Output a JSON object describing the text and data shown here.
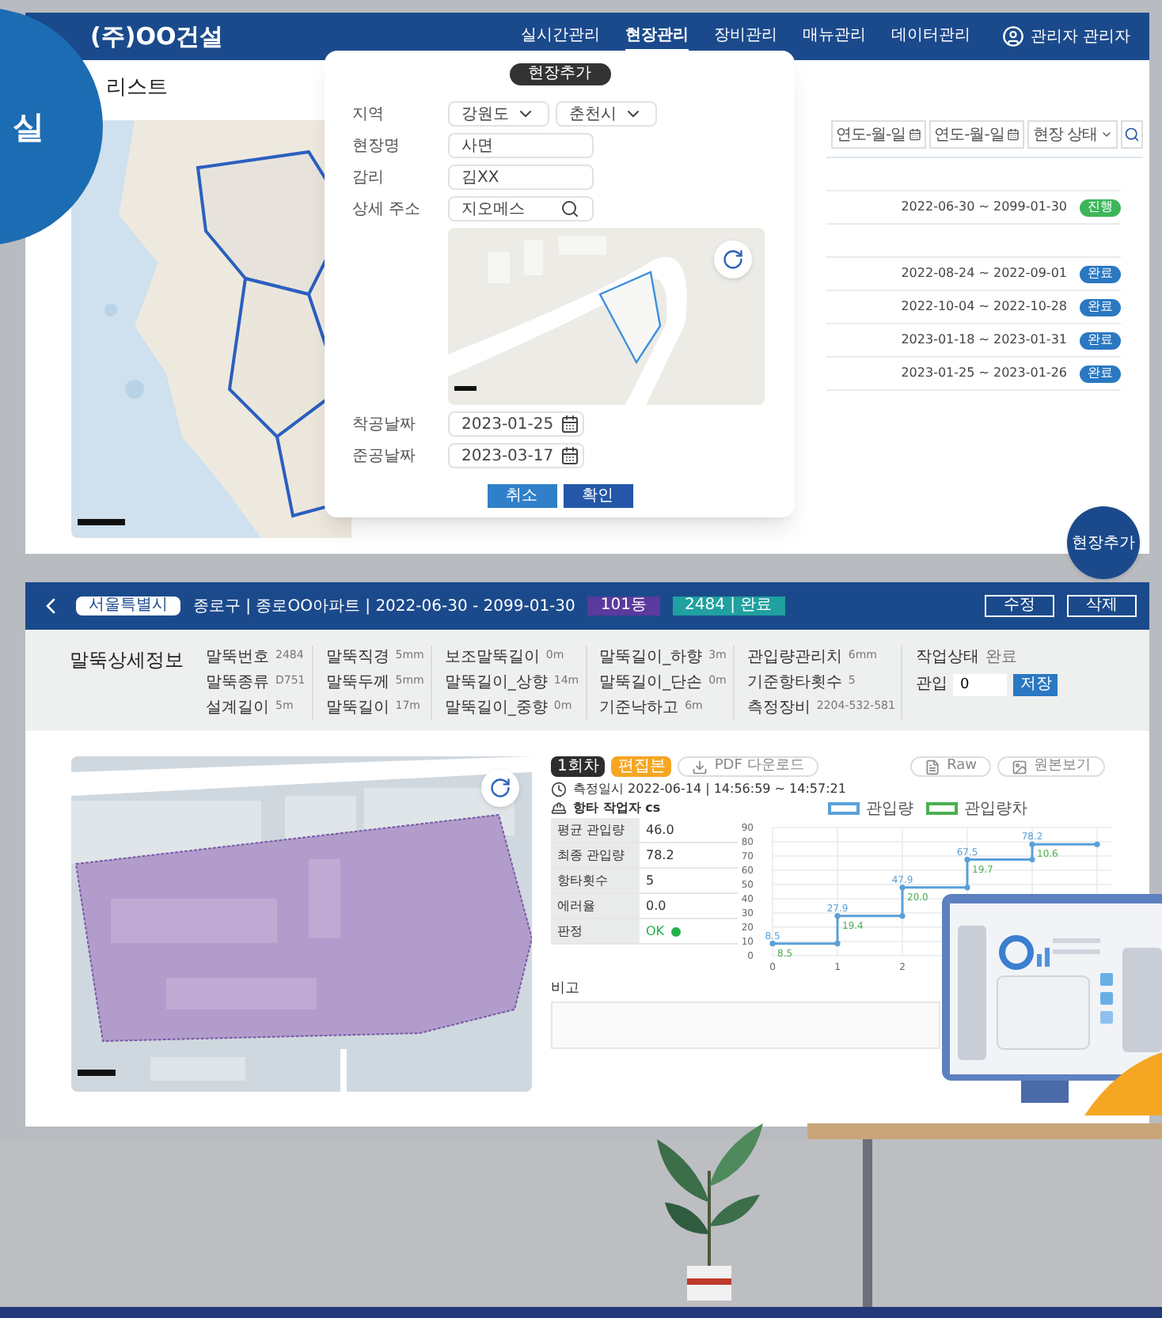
{
  "corner_badge": {
    "text": "실"
  },
  "top_window": {
    "brand": "(주)OO건설",
    "nav": [
      {
        "label": "실시간관리",
        "selected": false
      },
      {
        "label": "현장관리",
        "selected": true
      },
      {
        "label": "장비관리",
        "selected": false
      },
      {
        "label": "매뉴관리",
        "selected": false
      },
      {
        "label": "데이터관리",
        "selected": false
      }
    ],
    "user": "관리자 관리자",
    "page_title": "리스트",
    "filters": [
      {
        "kind": "date",
        "placeholder": "연도-월-일"
      },
      {
        "kind": "date",
        "placeholder": "연도-월-일"
      },
      {
        "kind": "select",
        "text": "현장 상태"
      },
      {
        "kind": "search"
      }
    ],
    "groups": [
      {
        "rows": [
          {
            "period": "2022-06-30 ~ 2099-01-30",
            "status": "진행",
            "kind": "progress"
          }
        ]
      },
      {
        "rows": [
          {
            "period": "2022-08-24 ~ 2022-09-01",
            "status": "완료",
            "kind": "done"
          },
          {
            "period": "2022-10-04 ~ 2022-10-28",
            "status": "완료",
            "kind": "done"
          },
          {
            "period": "2023-01-18 ~ 2023-01-31",
            "status": "완료",
            "kind": "done"
          },
          {
            "period": "2023-01-25 ~ 2023-01-26",
            "status": "완료",
            "kind": "done"
          }
        ]
      }
    ],
    "fab": "현장추가"
  },
  "modal": {
    "title": "현장추가",
    "fields": [
      {
        "label": "지역",
        "kind": "selects",
        "values": [
          "강원도",
          "춘천시"
        ]
      },
      {
        "label": "현장명",
        "kind": "text",
        "value": "사면"
      },
      {
        "label": "감리",
        "kind": "text",
        "value": "김XX"
      },
      {
        "label": "상세 주소",
        "kind": "search",
        "value": "지오메스"
      },
      {
        "kind": "map"
      },
      {
        "label": "착공날짜",
        "kind": "date",
        "value": "2023-01-25"
      },
      {
        "label": "준공날짜",
        "kind": "date",
        "value": "2023-03-17"
      }
    ],
    "buttons": [
      {
        "label": "취소",
        "kind": "secondary"
      },
      {
        "label": "확인",
        "kind": "primary"
      }
    ]
  },
  "bottom_window": {
    "region": "서울특별시",
    "breadcrumb": "종로구 | 종로OO아파트 | 2022-06-30 - 2099-01-30",
    "tags": [
      {
        "text": "101동",
        "color": "#5b3a9e"
      },
      {
        "text": "2484 | 완료",
        "color": "#20a0a0"
      }
    ],
    "buttons": [
      "수정",
      "삭제"
    ],
    "info_title": "말뚝상세정보",
    "info_columns": [
      [
        {
          "label": "말뚝번호",
          "value": "2484"
        },
        {
          "label": "말뚝종류",
          "value": "D751"
        },
        {
          "label": "설계길이",
          "value": "5m"
        }
      ],
      [
        {
          "label": "말뚝직경",
          "value": "5mm"
        },
        {
          "label": "말뚝두께",
          "value": "5mm"
        },
        {
          "label": "말뚝길이",
          "value": "17m"
        }
      ],
      [
        {
          "label": "보조말뚝길이",
          "value": "0m"
        },
        {
          "label": "말뚝길이_상향",
          "value": "14m"
        },
        {
          "label": "말뚝길이_중향",
          "value": "0m"
        }
      ],
      [
        {
          "label": "말뚝길이_하향",
          "value": "3m"
        },
        {
          "label": "말뚝길이_단손",
          "value": "0m"
        },
        {
          "label": "기준낙하고",
          "value": "6m"
        }
      ],
      [
        {
          "label": "관입량관리치",
          "value": "6mm"
        },
        {
          "label": "기준항타횟수",
          "value": "5"
        },
        {
          "label": "측정장비",
          "value": "2204-532-581"
        }
      ]
    ],
    "work_status": {
      "label": "작업상태",
      "value": "완료"
    },
    "penetration": {
      "label": "관입",
      "value": "0",
      "button": "저장"
    },
    "tabs": [
      {
        "label": "1회차",
        "selected": true
      },
      {
        "label": "편집본",
        "selected": false
      }
    ],
    "pdf_button": "PDF 다운로드",
    "raw_button": "Raw",
    "original_button": "원본보기",
    "measured_at": "측정일시 2022-06-14 | 14:56:59 ~ 14:57:21",
    "worker": "항타 작업자 cs",
    "stats": [
      {
        "label": "평균 관입량",
        "value": "46.0"
      },
      {
        "label": "최종 관입량",
        "value": "78.2"
      },
      {
        "label": "항타횟수",
        "value": "5"
      },
      {
        "label": "에러율",
        "value": "0.0"
      },
      {
        "label": "판정",
        "value": "OK",
        "color": "#22b24c"
      }
    ],
    "chart_data": {
      "type": "line",
      "x": [
        0,
        1,
        1,
        2,
        2,
        3,
        3,
        4,
        4,
        5
      ],
      "series": [
        {
          "name": "관입량",
          "color": "#5aa0d8",
          "marker": "circle",
          "values": [
            8.5,
            8.5,
            27.9,
            27.9,
            47.9,
            47.9,
            67.5,
            67.5,
            78.2,
            78.2
          ]
        }
      ],
      "xlim": [
        0,
        5
      ],
      "ylim": [
        0,
        90
      ],
      "xticks": [
        0,
        1,
        2
      ],
      "yticks": [
        0,
        10,
        20,
        30,
        40,
        50,
        60,
        70,
        80,
        90
      ],
      "grid": true,
      "value_labels": [
        [
          "8.5",
          null,
          "27.9",
          null,
          "47.9",
          null,
          "67.5",
          null,
          "78.2",
          null
        ]
      ],
      "annotations": [
        {
          "x": 0,
          "y": 8.5,
          "text": "8.5"
        },
        {
          "x": 1,
          "y": 27.9,
          "text": "19.4"
        },
        {
          "x": 2,
          "y": 47.9,
          "text": "20.0"
        },
        {
          "x": 3,
          "y": 67.5,
          "text": "19.7"
        },
        {
          "x": 4,
          "y": 78.2,
          "text": "10.6"
        }
      ]
    },
    "difference_legend": {
      "name": "관입량차",
      "color": "#4caf50"
    },
    "remarks_label": "비고"
  }
}
